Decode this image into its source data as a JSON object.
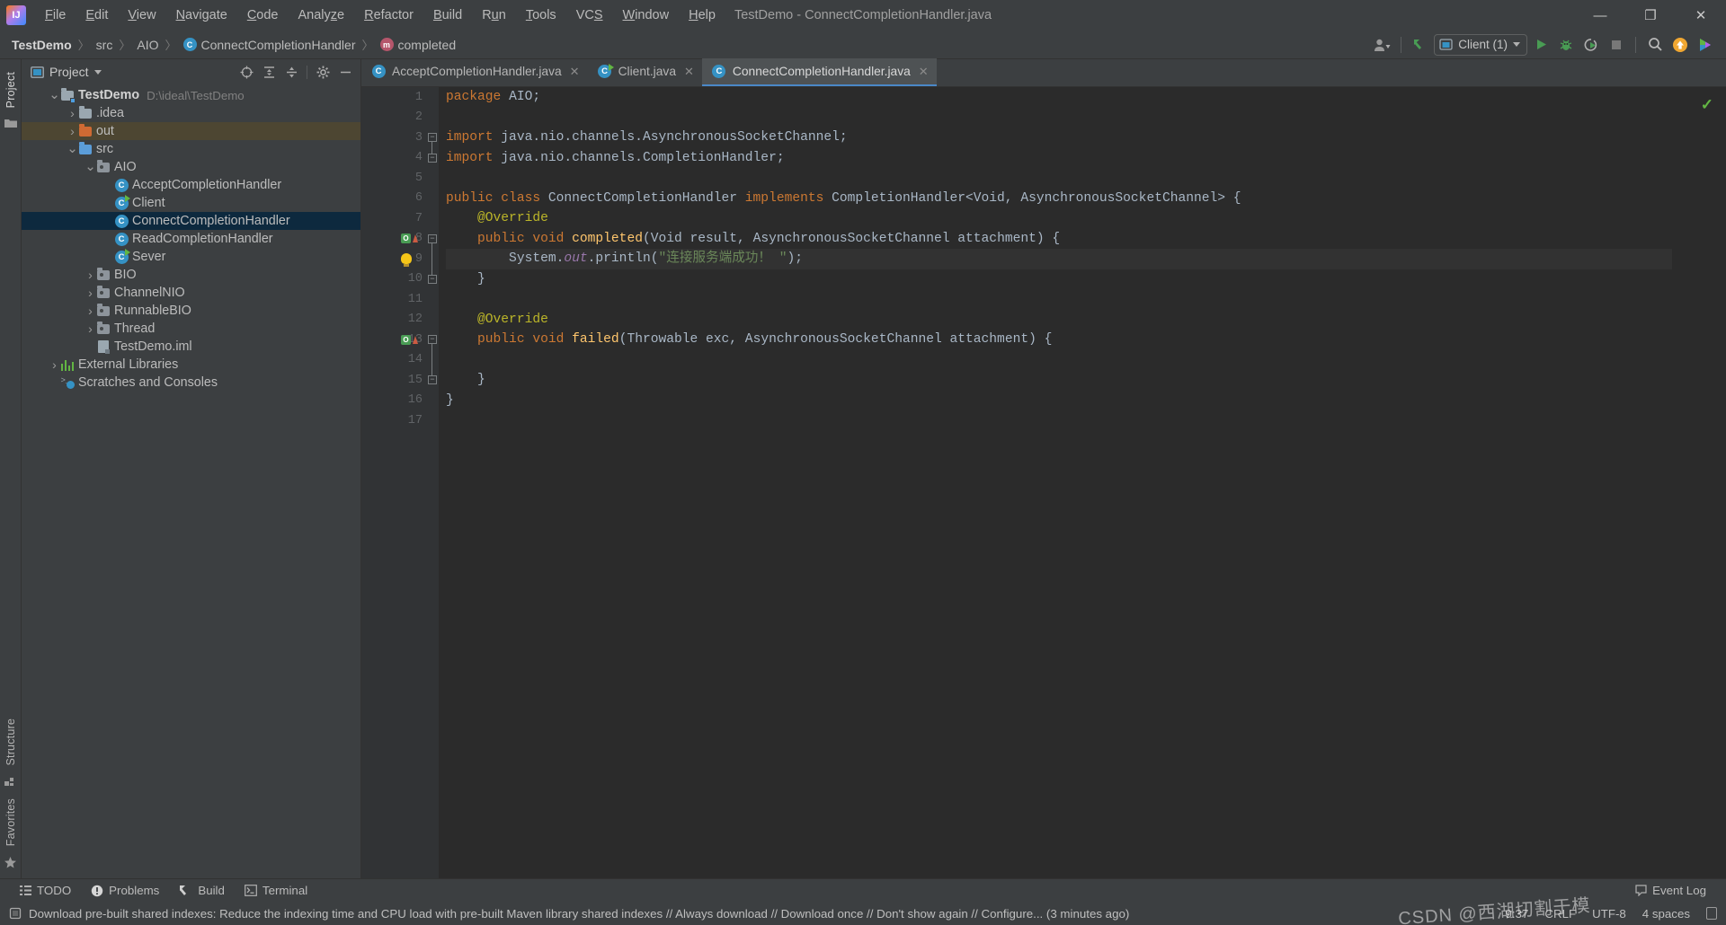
{
  "window": {
    "title": "TestDemo - ConnectCompletionHandler.java",
    "logo_text": "IJ",
    "minimize": "—",
    "maximize": "❐",
    "close": "✕"
  },
  "menubar": {
    "items": [
      {
        "label": "File",
        "mnemonic": "F"
      },
      {
        "label": "Edit",
        "mnemonic": "E"
      },
      {
        "label": "View",
        "mnemonic": "V"
      },
      {
        "label": "Navigate",
        "mnemonic": "N"
      },
      {
        "label": "Code",
        "mnemonic": "C"
      },
      {
        "label": "Analyze",
        "mnemonic": "z"
      },
      {
        "label": "Refactor",
        "mnemonic": "R"
      },
      {
        "label": "Build",
        "mnemonic": "B"
      },
      {
        "label": "Run",
        "mnemonic": "u"
      },
      {
        "label": "Tools",
        "mnemonic": "T"
      },
      {
        "label": "VCS",
        "mnemonic": "S"
      },
      {
        "label": "Window",
        "mnemonic": "W"
      },
      {
        "label": "Help",
        "mnemonic": "H"
      }
    ]
  },
  "navbar": {
    "crumbs": [
      {
        "label": "TestDemo",
        "icon": "none",
        "bold": true
      },
      {
        "label": "src",
        "icon": "none",
        "bold": false
      },
      {
        "label": "AIO",
        "icon": "none",
        "bold": false
      },
      {
        "label": "ConnectCompletionHandler",
        "icon": "class-badge",
        "bold": false
      },
      {
        "label": "completed",
        "icon": "method-badge",
        "bold": false
      }
    ],
    "separator": "〉",
    "class_badge_letter": "C",
    "method_badge_letter": "m",
    "run_config": {
      "label": "Client (1)",
      "icon": "run-config-icon"
    },
    "icons": [
      "user-avatar-icon",
      "update-project-icon",
      "run-icon",
      "debug-icon",
      "run-with-coverage-icon",
      "stop-icon",
      "search-everywhere-icon",
      "ide-update-icon",
      "feedback-icon"
    ]
  },
  "left_strip": {
    "top_label": "Project",
    "bottom_labels": [
      "Structure",
      "Favorites"
    ]
  },
  "project_panel": {
    "header": {
      "title": "Project",
      "icons": [
        "scroll-from-source-icon",
        "expand-all-icon",
        "collapse-all-icon",
        "settings-gear-icon",
        "hide-panel-icon"
      ]
    },
    "tree": [
      {
        "label": "TestDemo",
        "path": "D:\\ideal\\TestDemo",
        "icon": "module-folder",
        "indent": 0,
        "arrow": "open",
        "bold": true,
        "state": "normal"
      },
      {
        "label": ".idea",
        "path": "",
        "icon": "folder-gray",
        "indent": 1,
        "arrow": "closed",
        "bold": false,
        "state": "normal"
      },
      {
        "label": "out",
        "path": "",
        "icon": "folder-orange",
        "indent": 1,
        "arrow": "closed",
        "bold": false,
        "state": "highlight"
      },
      {
        "label": "src",
        "path": "",
        "icon": "folder-blue",
        "indent": 1,
        "arrow": "open",
        "bold": false,
        "state": "normal"
      },
      {
        "label": "AIO",
        "path": "",
        "icon": "package-folder",
        "indent": 2,
        "arrow": "open",
        "bold": false,
        "state": "normal"
      },
      {
        "label": "AcceptCompletionHandler",
        "path": "",
        "icon": "java-class",
        "indent": 3,
        "arrow": "none",
        "bold": false,
        "state": "normal"
      },
      {
        "label": "Client",
        "path": "",
        "icon": "java-class-runnable",
        "indent": 3,
        "arrow": "none",
        "bold": false,
        "state": "normal"
      },
      {
        "label": "ConnectCompletionHandler",
        "path": "",
        "icon": "java-class",
        "indent": 3,
        "arrow": "none",
        "bold": false,
        "state": "selected"
      },
      {
        "label": "ReadCompletionHandler",
        "path": "",
        "icon": "java-class",
        "indent": 3,
        "arrow": "none",
        "bold": false,
        "state": "normal"
      },
      {
        "label": "Sever",
        "path": "",
        "icon": "java-class-runnable",
        "indent": 3,
        "arrow": "none",
        "bold": false,
        "state": "normal"
      },
      {
        "label": "BIO",
        "path": "",
        "icon": "package-folder",
        "indent": 2,
        "arrow": "closed",
        "bold": false,
        "state": "normal"
      },
      {
        "label": "ChannelNIO",
        "path": "",
        "icon": "package-folder",
        "indent": 2,
        "arrow": "closed",
        "bold": false,
        "state": "normal"
      },
      {
        "label": "RunnableBIO",
        "path": "",
        "icon": "package-folder",
        "indent": 2,
        "arrow": "closed",
        "bold": false,
        "state": "normal"
      },
      {
        "label": "Thread",
        "path": "",
        "icon": "package-folder",
        "indent": 2,
        "arrow": "closed",
        "bold": false,
        "state": "normal"
      },
      {
        "label": "TestDemo.iml",
        "path": "",
        "icon": "iml-file",
        "indent": 2,
        "arrow": "none",
        "bold": false,
        "state": "normal"
      },
      {
        "label": "External Libraries",
        "path": "",
        "icon": "libraries",
        "indent": 0,
        "arrow": "closed",
        "bold": false,
        "state": "normal"
      },
      {
        "label": "Scratches and Consoles",
        "path": "",
        "icon": "scratches",
        "indent": 0,
        "arrow": "none",
        "bold": false,
        "state": "normal"
      }
    ]
  },
  "editor": {
    "tabs": [
      {
        "label": "AcceptCompletionHandler.java",
        "icon": "java-class",
        "active": false,
        "close": "✕"
      },
      {
        "label": "Client.java",
        "icon": "java-class-runnable",
        "active": false,
        "close": "✕"
      },
      {
        "label": "ConnectCompletionHandler.java",
        "icon": "java-class",
        "active": true,
        "close": "✕"
      }
    ],
    "line_numbers": [
      "1",
      "2",
      "3",
      "4",
      "5",
      "6",
      "7",
      "8",
      "9",
      "10",
      "11",
      "12",
      "13",
      "14",
      "15",
      "16",
      "17"
    ],
    "lines": [
      {
        "n": 1,
        "segments": [
          {
            "t": "package",
            "c": "kw"
          },
          {
            "t": " AIO",
            "c": "plain"
          },
          {
            "t": ";",
            "c": "plain"
          }
        ]
      },
      {
        "n": 2,
        "segments": []
      },
      {
        "n": 3,
        "segments": [
          {
            "t": "import",
            "c": "kw"
          },
          {
            "t": " java.nio.channels.AsynchronousSocketChannel;",
            "c": "plain"
          }
        ]
      },
      {
        "n": 4,
        "segments": [
          {
            "t": "import",
            "c": "kw"
          },
          {
            "t": " java.nio.channels.CompletionHandler;",
            "c": "plain"
          }
        ]
      },
      {
        "n": 5,
        "segments": []
      },
      {
        "n": 6,
        "segments": [
          {
            "t": "public class",
            "c": "kw"
          },
          {
            "t": " ConnectCompletionHandler ",
            "c": "plain"
          },
          {
            "t": "implements",
            "c": "kw"
          },
          {
            "t": " CompletionHandler<Void, AsynchronousSocketChannel> {",
            "c": "plain"
          }
        ]
      },
      {
        "n": 7,
        "segments": [
          {
            "t": "    @Override",
            "c": "ann"
          }
        ]
      },
      {
        "n": 8,
        "segments": [
          {
            "t": "    ",
            "c": "plain"
          },
          {
            "t": "public void",
            "c": "kw"
          },
          {
            "t": " ",
            "c": "plain"
          },
          {
            "t": "completed",
            "c": "mth"
          },
          {
            "t": "(Void result, AsynchronousSocketChannel attachment) {",
            "c": "plain"
          }
        ]
      },
      {
        "n": 9,
        "segments": [
          {
            "t": "        System.",
            "c": "plain"
          },
          {
            "t": "out",
            "c": "fld"
          },
          {
            "t": ".println(",
            "c": "plain"
          },
          {
            "t": "\"连接服务端成功！ \"",
            "c": "str"
          },
          {
            "t": ");",
            "c": "plain"
          }
        ]
      },
      {
        "n": 10,
        "segments": [
          {
            "t": "    }",
            "c": "plain"
          }
        ]
      },
      {
        "n": 11,
        "segments": []
      },
      {
        "n": 12,
        "segments": [
          {
            "t": "    @Override",
            "c": "ann"
          }
        ]
      },
      {
        "n": 13,
        "segments": [
          {
            "t": "    ",
            "c": "plain"
          },
          {
            "t": "public void",
            "c": "kw"
          },
          {
            "t": " ",
            "c": "plain"
          },
          {
            "t": "failed",
            "c": "mth"
          },
          {
            "t": "(Throwable exc, AsynchronousSocketChannel attachment) {",
            "c": "plain"
          }
        ]
      },
      {
        "n": 14,
        "segments": []
      },
      {
        "n": 15,
        "segments": [
          {
            "t": "    }",
            "c": "plain"
          }
        ]
      },
      {
        "n": 16,
        "segments": [
          {
            "t": "}",
            "c": "plain"
          }
        ]
      },
      {
        "n": 17,
        "segments": []
      }
    ],
    "gutter_markers": [
      {
        "line": 8,
        "type": "implements-method-icon"
      },
      {
        "line": 13,
        "type": "implements-method-icon"
      },
      {
        "line": 9,
        "type": "intention-bulb-icon"
      }
    ],
    "inspection_status": "ok-checkmark-icon"
  },
  "bottom_tool_windows": [
    {
      "label": "TODO",
      "icon": "todo-icon"
    },
    {
      "label": "Problems",
      "icon": "problems-icon"
    },
    {
      "label": "Build",
      "icon": "build-hammer-icon"
    },
    {
      "label": "Terminal",
      "icon": "terminal-icon"
    }
  ],
  "event_log": {
    "label": "Event Log",
    "icon": "event-log-icon"
  },
  "statusbar": {
    "message": "Download pre-built shared indexes: Reduce the indexing time and CPU load with pre-built Maven library shared indexes // Always download // Download once // Don't show again // Configure... (3 minutes ago)",
    "message_icon": "notification-icon",
    "caret_position": "9:37",
    "line_separator": "CRLF",
    "encoding": "UTF-8",
    "indent": "4 spaces",
    "lock_icon": "read-write-lock-icon",
    "watermark": "CSDN @西湖切割于模"
  },
  "colors": {
    "background": "#3c3f41",
    "editor_background": "#2b2b2b",
    "gutter_background": "#313335",
    "selection": "#0d293e",
    "accent_blue": "#4a88c7",
    "keyword_orange": "#cc7832",
    "string_green": "#6a8759",
    "annotation_yellow": "#bbb529",
    "method_yellow": "#ffc66d",
    "field_purple": "#9876aa",
    "ok_green": "#62b543"
  }
}
